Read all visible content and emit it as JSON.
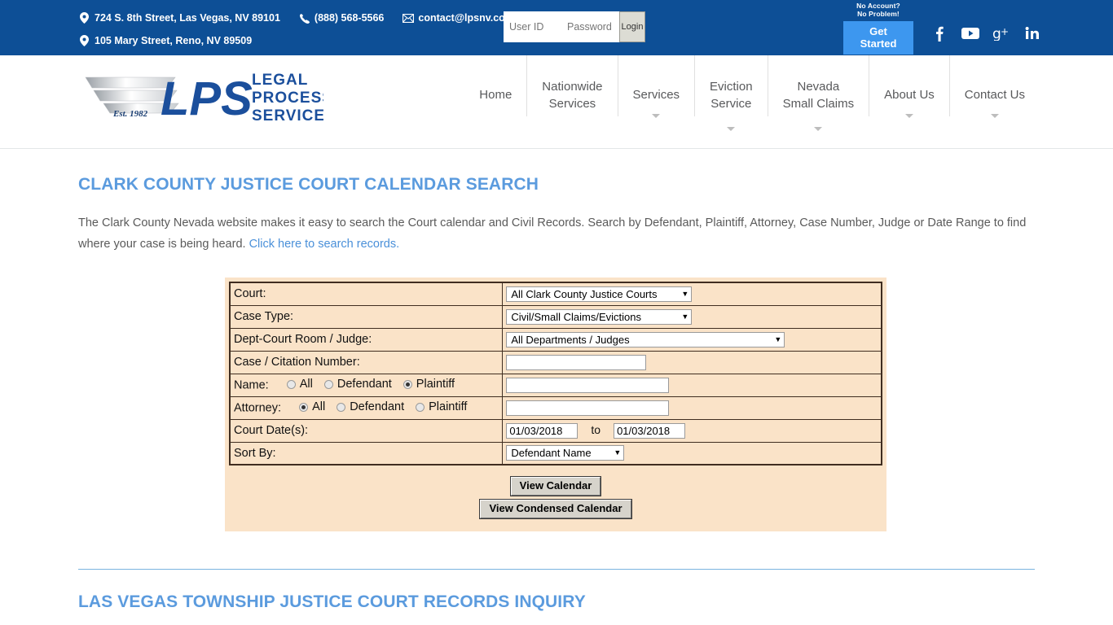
{
  "topbar": {
    "addresses": [
      "724 S. 8th Street, Las Vegas, NV 89101",
      "105 Mary Street, Reno, NV 89509"
    ],
    "phone": "(888) 568-5566",
    "email": "contact@lpsnv.com",
    "login": {
      "userid_placeholder": "User ID",
      "password_placeholder": "Password",
      "login_label": "Login"
    },
    "cta": {
      "kicker_line1": "No Account?",
      "kicker_line2": "No Problem!",
      "button_line1": "Get",
      "button_line2": "Started"
    },
    "socials": [
      "facebook-icon",
      "youtube-icon",
      "google-plus-icon",
      "linkedin-icon"
    ],
    "background": "#0d4f96"
  },
  "logo": {
    "mark": "LPS",
    "est": "Est. 1982",
    "words": [
      "LEGAL",
      "PROCESS",
      "SERVICE"
    ],
    "color": "#1b4f9c"
  },
  "nav": {
    "items": [
      {
        "label": "Home",
        "line1": "Home",
        "line2": "",
        "caret": false
      },
      {
        "label": "Nationwide Services",
        "line1": "Nationwide",
        "line2": "Services",
        "caret": false
      },
      {
        "label": "Services",
        "line1": "Services",
        "line2": "",
        "caret": true
      },
      {
        "label": "Eviction Service",
        "line1": "Eviction",
        "line2": "Service",
        "caret": true
      },
      {
        "label": "Nevada Small Claims",
        "line1": "Nevada",
        "line2": "Small Claims",
        "caret": true
      },
      {
        "label": "About Us",
        "line1": "About Us",
        "line2": "",
        "caret": true
      },
      {
        "label": "Contact Us",
        "line1": "Contact Us",
        "line2": "",
        "caret": true
      }
    ]
  },
  "main": {
    "title": "CLARK COUNTY JUSTICE COURT CALENDAR SEARCH",
    "intro_text": "The Clark County Nevada website makes it easy to search the Court calendar and Civil Records. Search by Defendant, Plaintiff, Attorney, Case Number, Judge or Date Range to find where your case is being heard. ",
    "intro_link": "Click here to search records.",
    "accent_color": "#5b9bde"
  },
  "form": {
    "rows": {
      "court_label": "Court:",
      "court_value": "All Clark County Justice Courts",
      "case_type_label": "Case Type:",
      "case_type_value": "Civil/Small Claims/Evictions",
      "dept_label": "Dept-Court Room / Judge:",
      "dept_value": "All Departments / Judges",
      "case_number_label": "Case / Citation Number:",
      "case_number_value": "",
      "name_label": "Name:",
      "name_value": "",
      "attorney_label": "Attorney:",
      "attorney_value": "",
      "court_dates_label": "Court Date(s):",
      "date_from": "01/03/2018",
      "date_to_text": "to",
      "date_to": "01/03/2018",
      "sort_label": "Sort By:",
      "sort_value": "Defendant Name"
    },
    "radio_options": [
      "All",
      "Defendant",
      "Plaintiff"
    ],
    "name_selected": "Plaintiff",
    "attorney_selected": "All",
    "buttons": {
      "view_calendar": "View Calendar",
      "view_condensed": "View Condensed Calendar"
    },
    "panel_background": "#fae3c8",
    "border_color": "#3f2d20"
  },
  "bottom": {
    "title": "LAS VEGAS TOWNSHIP JUSTICE COURT RECORDS INQUIRY"
  }
}
